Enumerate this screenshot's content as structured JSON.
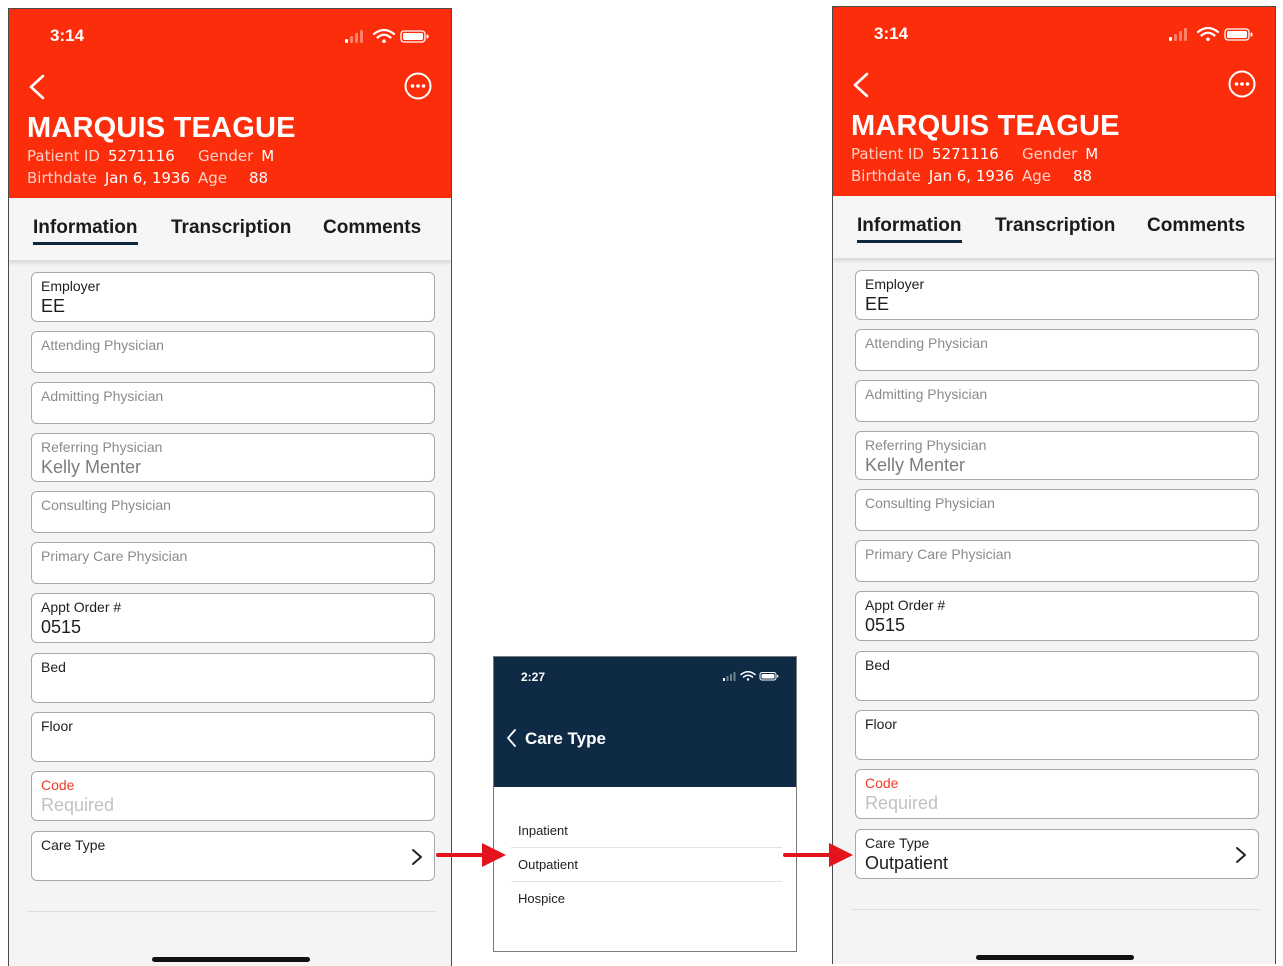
{
  "patient_screen": {
    "time": "3:14",
    "patient_name": "MARQUIS TEAGUE",
    "patient_id_label": "Patient ID",
    "patient_id": "5271116",
    "gender_label": "Gender",
    "gender": "M",
    "birthdate_label": "Birthdate",
    "birthdate": "Jan 6, 1936",
    "age_label": "Age",
    "age": "88",
    "tabs": [
      "Information",
      "Transcription",
      "Comments"
    ],
    "fields": {
      "employer": {
        "label": "Employer",
        "value": "EE"
      },
      "attending": {
        "label": "Attending Physician",
        "value": ""
      },
      "admitting": {
        "label": "Admitting Physician",
        "value": ""
      },
      "referring": {
        "label": "Referring Physician",
        "value": "Kelly Menter"
      },
      "consulting": {
        "label": "Consulting Physician",
        "value": ""
      },
      "primary_care": {
        "label": "Primary Care Physician",
        "value": ""
      },
      "appt_order": {
        "label": "Appt Order #",
        "value": "0515"
      },
      "bed": {
        "label": "Bed",
        "value": ""
      },
      "floor": {
        "label": "Floor",
        "value": ""
      },
      "code": {
        "label": "Code",
        "value": "Required"
      },
      "care_type": {
        "label": "Care Type",
        "value_before": "",
        "value_after": "Outpatient"
      }
    }
  },
  "care_type_screen": {
    "time": "2:27",
    "title": "Care Type",
    "options": [
      "Inpatient",
      "Outpatient",
      "Hospice"
    ]
  },
  "colors": {
    "header_red": "#fb2d0b",
    "navy": "#0e2a44",
    "arrow_red": "#e3141b",
    "code_label_red": "#f03b2b"
  }
}
